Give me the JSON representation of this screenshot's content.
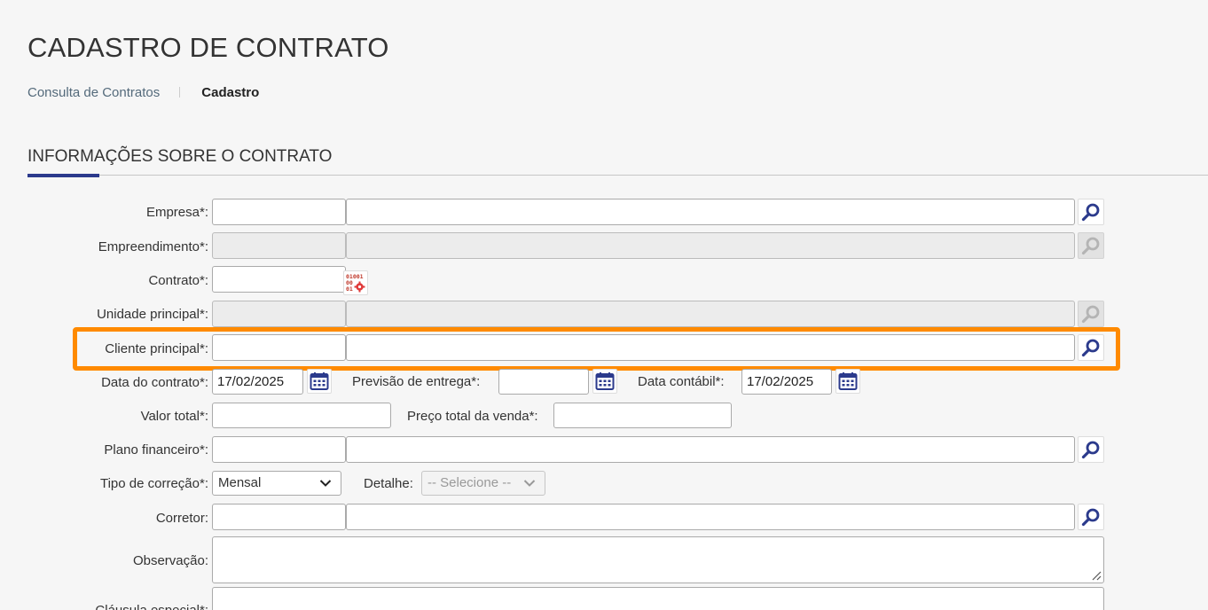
{
  "page": {
    "title": "CADASTRO DE CONTRATO",
    "breadcrumb": {
      "link": "Consulta de Contratos",
      "current": "Cadastro"
    },
    "section_title": "INFORMAÇÕES SOBRE O CONTRATO"
  },
  "form": {
    "empresa": {
      "label": "Empresa*:",
      "code": "",
      "name": ""
    },
    "empreendimento": {
      "label": "Empreendimento*:",
      "code": "",
      "name": ""
    },
    "contrato": {
      "label": "Contrato*:",
      "value": ""
    },
    "unidade_principal": {
      "label": "Unidade principal*:",
      "code": "",
      "name": ""
    },
    "cliente_principal": {
      "label": "Cliente principal*:",
      "code": "",
      "name": ""
    },
    "data_contrato": {
      "label": "Data do contrato*:",
      "value": "17/02/2025"
    },
    "previsao_entrega": {
      "label": "Previsão de entrega*:",
      "value": ""
    },
    "data_contabil": {
      "label": "Data contábil*:",
      "value": "17/02/2025"
    },
    "valor_total": {
      "label": "Valor total*:",
      "value": ""
    },
    "preco_total_venda": {
      "label": "Preço total da venda*:",
      "value": ""
    },
    "plano_financeiro": {
      "label": "Plano financeiro*:",
      "code": "",
      "name": ""
    },
    "tipo_correcao": {
      "label": "Tipo de correção*:",
      "selected": "Mensal"
    },
    "detalhe": {
      "label": "Detalhe:",
      "selected": "-- Selecione --"
    },
    "corretor": {
      "label": "Corretor:",
      "code": "",
      "name": ""
    },
    "observacao": {
      "label": "Observação:",
      "value": ""
    },
    "clausula_especial": {
      "label": "Cláusula especial*:"
    }
  },
  "icons": {
    "search": "magnifier-icon",
    "calendar": "calendar-icon",
    "generate": "binary-gear-icon"
  },
  "colors": {
    "accent": "#2b3a8c",
    "highlight": "#ff8a00",
    "icon_blue": "#2b3a8c"
  }
}
